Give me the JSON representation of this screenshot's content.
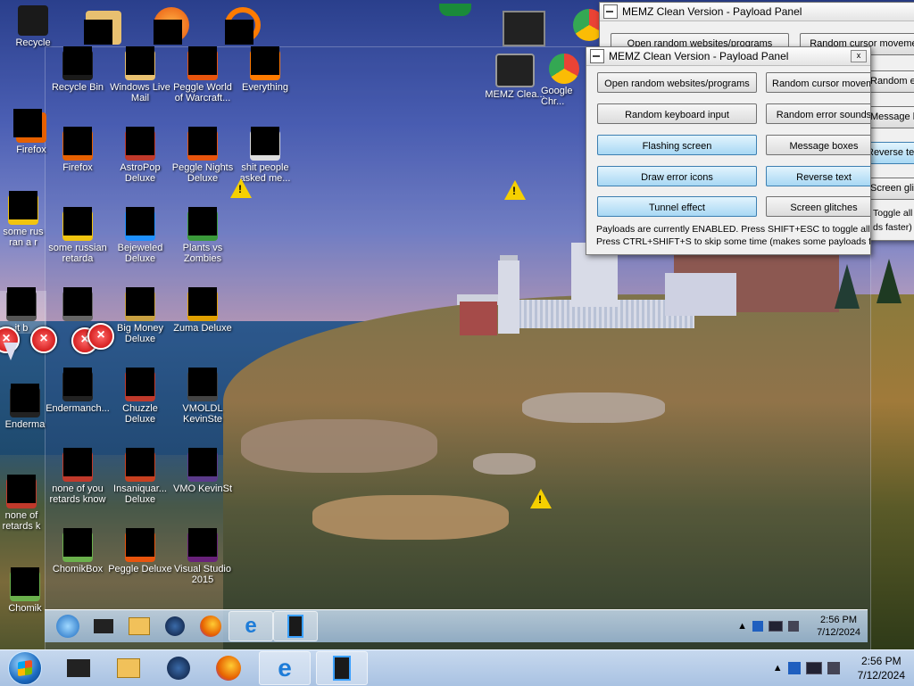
{
  "desktop": {
    "outer_icons": [
      {
        "label": "Recycle",
        "name": "recycle-bin-icon"
      },
      {
        "label": "Firefox",
        "name": "firefox-icon"
      },
      {
        "label": "some rus ran a r",
        "name": "document-icon"
      },
      {
        "label": "it b",
        "name": "shortcut-icon"
      },
      {
        "label": "Enderma",
        "name": "enderman-icon"
      },
      {
        "label": "none of retards k",
        "name": "tf2-icon"
      },
      {
        "label": "Chomik",
        "name": "chomik-icon"
      }
    ],
    "grid_icons": [
      {
        "label": "Recycle Bin",
        "name": "recycle-bin-icon"
      },
      {
        "label": "Windows Live Mail",
        "name": "windows-live-mail-icon"
      },
      {
        "label": "Peggle World of Warcraft...",
        "name": "peggle-wow-icon"
      },
      {
        "label": "Everything",
        "name": "everything-icon"
      },
      {
        "label": "Firefox",
        "name": "firefox-icon"
      },
      {
        "label": "AstroPop Deluxe",
        "name": "astropop-icon"
      },
      {
        "label": "Peggle Nights Deluxe",
        "name": "peggle-nights-icon"
      },
      {
        "label": "shit people asked me...",
        "name": "folder-icon"
      },
      {
        "label": "some russian retarda",
        "name": "document-icon"
      },
      {
        "label": "Bejeweled Deluxe",
        "name": "bejeweled-icon"
      },
      {
        "label": "Plants vs Zombies",
        "name": "pvz-icon"
      },
      {
        "label": "",
        "name": "shortcut-icon"
      },
      {
        "label": "Big Money Deluxe",
        "name": "big-money-icon"
      },
      {
        "label": "Zuma Deluxe",
        "name": "zuma-icon"
      },
      {
        "label": "Endermanch...",
        "name": "enderman-icon"
      },
      {
        "label": "Chuzzle Deluxe",
        "name": "chuzzle-icon"
      },
      {
        "label": "VMOLDL KevinSte",
        "name": "vm-icon"
      },
      {
        "label": "none of you retards know",
        "name": "tf2-icon"
      },
      {
        "label": "Insaniquar... Deluxe",
        "name": "insaniquarium-icon"
      },
      {
        "label": "VMO KevinSt",
        "name": "vm-icon"
      },
      {
        "label": "ChomikBox",
        "name": "chomik-icon"
      },
      {
        "label": "Peggle Deluxe",
        "name": "peggle-icon"
      },
      {
        "label": "Visual Studio 2015",
        "name": "visual-studio-icon"
      }
    ],
    "right_icons": [
      {
        "label": "MEMZ Clea...",
        "name": "memz-icon"
      },
      {
        "label": "Google Chr...",
        "name": "chrome-icon"
      }
    ]
  },
  "panel": {
    "title": "MEMZ Clean Version - Payload Panel",
    "close_label": "x",
    "buttons": [
      {
        "label": "Open random websites/programs",
        "on": false
      },
      {
        "label": "Random cursor movement",
        "on": false
      },
      {
        "label": "Random keyboard input",
        "on": false
      },
      {
        "label": "Random error sounds",
        "on": false
      },
      {
        "label": "Flashing screen",
        "on": true
      },
      {
        "label": "Message boxes",
        "on": false
      },
      {
        "label": "Draw error icons",
        "on": true
      },
      {
        "label": "Reverse text",
        "on": true
      },
      {
        "label": "Tunnel effect",
        "on": true
      },
      {
        "label": "Screen glitches",
        "on": false
      }
    ],
    "status_line1": "Payloads are currently ENABLED. Press SHIFT+ESC to toggle all payloads!",
    "status_line2": "Press CTRL+SHIFT+S to skip some time (makes some payloads faster)"
  },
  "ghost_panel": {
    "title": "MEMZ Clean Version - Payload Panel",
    "buttons": [
      "Open random websites/programs",
      "Random cursor movement",
      "Random error sounds",
      "Message boxes",
      "Reverse text",
      "Screen glitches",
      "Toggle all payloads",
      "ds faster)"
    ]
  },
  "taskbar": {
    "apps": [
      {
        "name": "media-center-icon",
        "active": false
      },
      {
        "name": "explorer-icon",
        "active": false
      },
      {
        "name": "media-player-icon",
        "active": false
      },
      {
        "name": "firefox-icon",
        "active": false
      },
      {
        "name": "ie-icon",
        "active": true
      },
      {
        "name": "memz-taskbar-icon",
        "active": true
      }
    ],
    "tray_arrow": "▲",
    "time": "2:56 PM",
    "date": "7/12/2024"
  },
  "warning_icons_count": 4
}
